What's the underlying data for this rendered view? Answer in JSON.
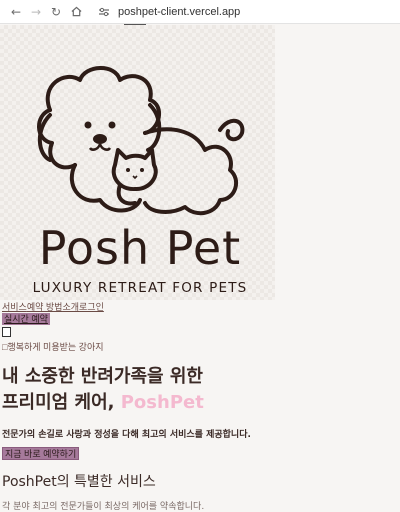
{
  "browser": {
    "url": "poshpet-client.vercel.app"
  },
  "hero": {
    "brand": "Posh Pet",
    "tagline": "LUXURY RETREAT FOR PETS"
  },
  "nav": {
    "links": [
      "서비스",
      "예약 방법",
      "소개",
      "로그인"
    ],
    "realtime_button": "실시간 예약",
    "broken_image_alt": "행복하게 미용받는 강아지"
  },
  "main": {
    "headline_line1": "내 소중한 반려가족을 위한",
    "headline_line2_prefix": "프리미엄 케어, ",
    "headline_highlight": "PoshPet",
    "description": "전문가의 손길로 사랑과 정성을 다해 최고의 서비스를 제공합니다.",
    "cta": "지금 바로 예약하기",
    "section_title": "PoshPet의 특별한 서비스",
    "section_subtitle": "각 분야 최고의 전문가들이 최상의 케어를 약속합니다."
  },
  "colors": {
    "accent_button": "#a67a9b",
    "highlight_pink": "#f4b9cf",
    "brand_brown": "#2d1c17"
  }
}
